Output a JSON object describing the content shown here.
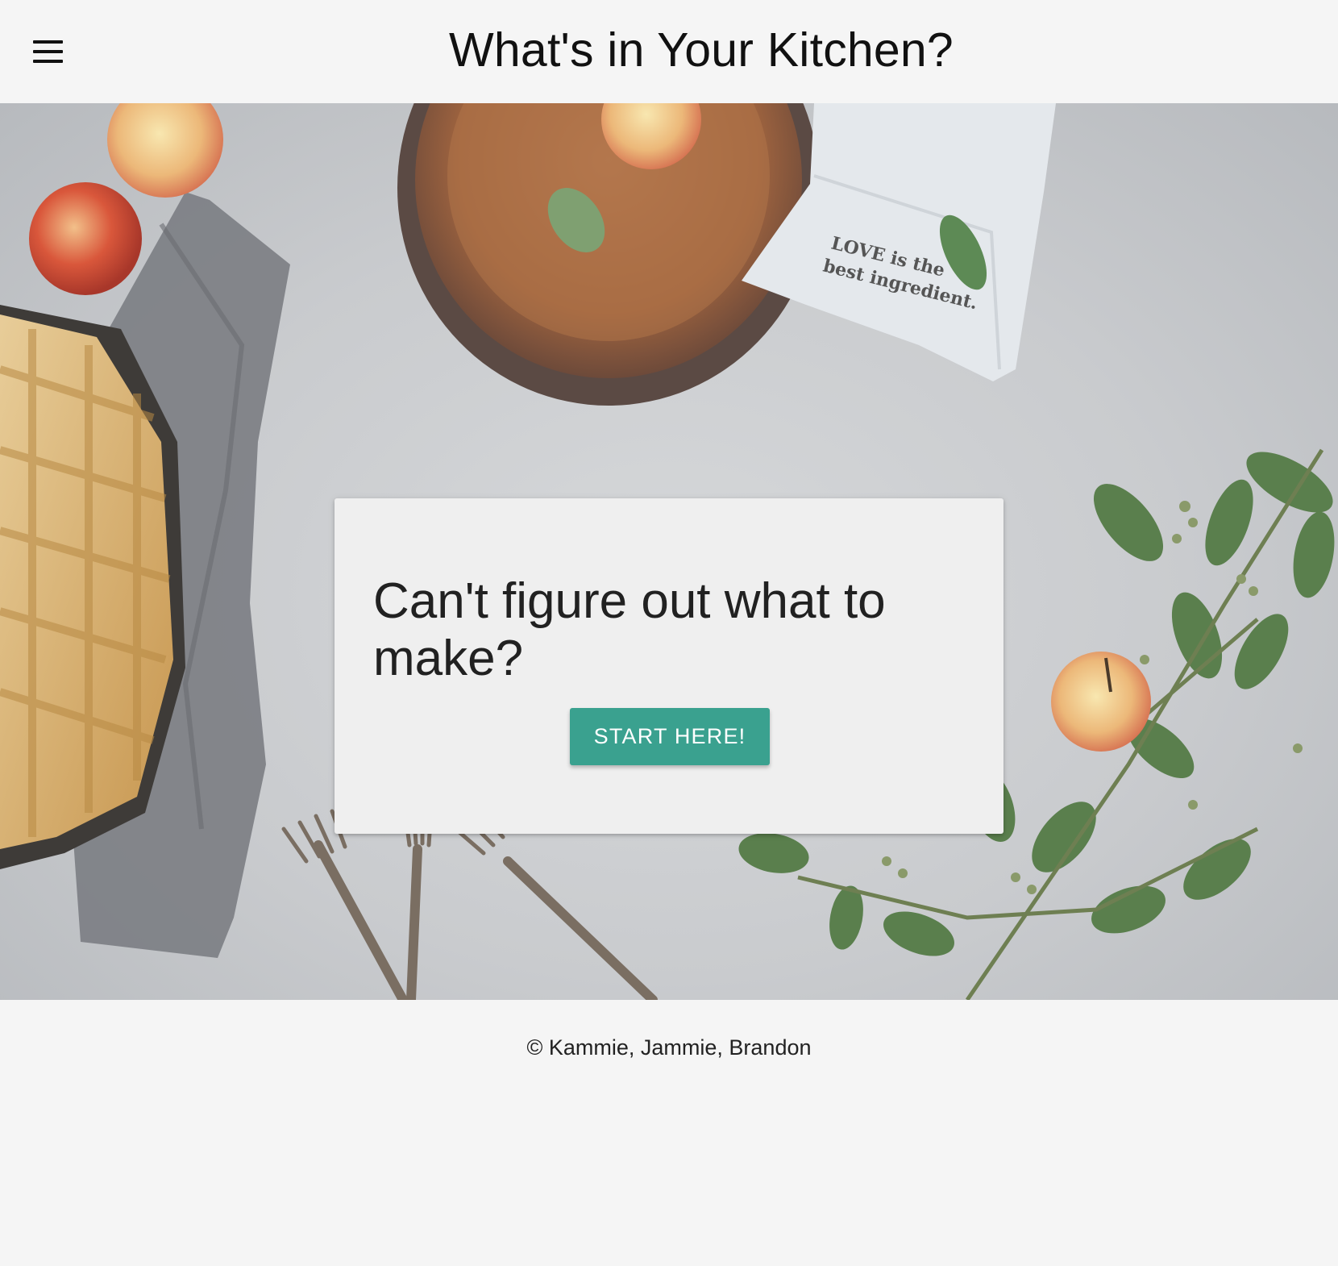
{
  "header": {
    "title": "What's in Your Kitchen?",
    "menu_icon": "hamburger-menu-icon"
  },
  "hero": {
    "background_image": "kitchen-table-photo",
    "card": {
      "heading": "Can't figure out what to make?",
      "button_label": "START HERE!"
    },
    "napkin_text": {
      "line1": "LOVE is the",
      "line2": "best ingredient."
    }
  },
  "footer": {
    "text": "© Kammie, Jammie, Brandon"
  },
  "colors": {
    "accent": "#3aa18f",
    "page_background": "#f5f5f5",
    "card_background": "#efefef"
  }
}
